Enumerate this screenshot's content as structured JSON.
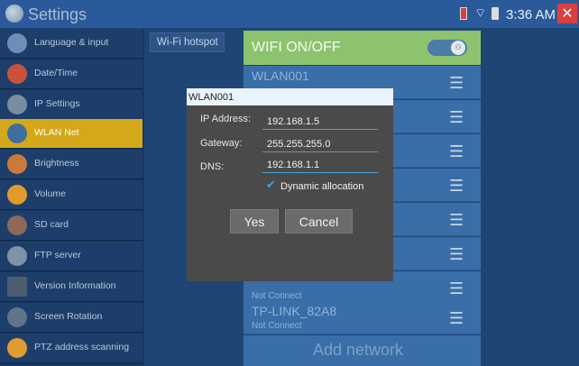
{
  "status_bar": {
    "title": "Settings",
    "time": "3:36 AM",
    "close_glyph": "✕",
    "wifi_glyph": "⌔"
  },
  "sidebar": {
    "items": [
      {
        "label": "Language & input",
        "icon": "language-icon",
        "color": "#6d8fb6"
      },
      {
        "label": "Date/Time",
        "icon": "calendar-icon",
        "color": "#c9513d"
      },
      {
        "label": "IP Settings",
        "icon": "globe-icon",
        "color": "#7a8da0"
      },
      {
        "label": "WLAN Net",
        "icon": "wrench-icon",
        "color": "#3f6f9f"
      },
      {
        "label": "Brightness",
        "icon": "brightness-icon",
        "color": "#cc7a3b"
      },
      {
        "label": "Volume",
        "icon": "volume-icon",
        "color": "#e39a2d"
      },
      {
        "label": "SD card",
        "icon": "sd-card-icon",
        "color": "#8b6a5a"
      },
      {
        "label": "FTP server",
        "icon": "ftp-icon",
        "color": "#7f93a8"
      },
      {
        "label": "Version Information",
        "icon": "monitor-icon",
        "color": "#4d5d70"
      },
      {
        "label": "Screen Rotation",
        "icon": "rotation-icon",
        "color": "#5f7488"
      },
      {
        "label": "PTZ address scanning",
        "icon": "ptz-icon",
        "color": "#e09c33"
      }
    ],
    "active_index": 3
  },
  "main": {
    "hotspot_tab": "Wi-Fi hotspot",
    "wifi_onoff": "WIFI ON/OFF",
    "toggle_knob": "⚇",
    "networks": [
      {
        "name": "WLAN001",
        "status": ""
      },
      {
        "name": "",
        "status": ""
      },
      {
        "name": "",
        "status": ""
      },
      {
        "name": "",
        "status": ""
      },
      {
        "name": "",
        "status": ""
      },
      {
        "name": "",
        "status": ""
      },
      {
        "name": "",
        "status": "Not Connect"
      },
      {
        "name": "TP-LINK_82A8",
        "status": "Not Connect"
      }
    ],
    "signal_glyph": "☰",
    "add_network": "Add network"
  },
  "dialog": {
    "title": "WLAN001",
    "ip_label": "IP Address:",
    "ip_value": "192.168.1.5",
    "gateway_label": "Gateway:",
    "gateway_value": "255.255.255.0",
    "dns_label": "DNS:",
    "dns_value": "192.168.1.1",
    "dynamic_label": "Dynamic allocation",
    "dynamic_checked": true,
    "check_glyph": "✔",
    "yes_label": "Yes",
    "cancel_label": "Cancel"
  }
}
